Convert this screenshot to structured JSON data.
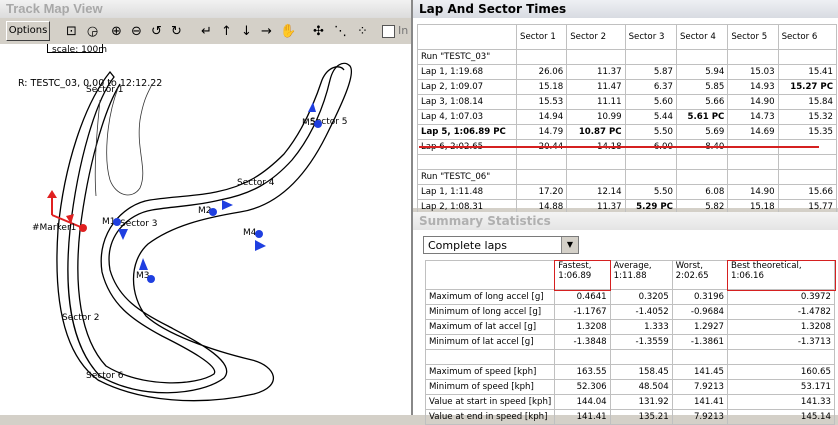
{
  "trackmap": {
    "title": "Track Map View",
    "options_label": "Options",
    "scale_label": "scale: 100m",
    "run_label": "R: TESTC_03, 0.00 to 12:12.22",
    "checkbox_label": "In",
    "marker_label": "#Marker1",
    "sector_labels": [
      "Sector 1",
      "Sector 2",
      "Sector 3",
      "Sector 4",
      "Sector 5",
      "Sector 6"
    ],
    "marker_names": [
      "M1",
      "M2",
      "M3",
      "M4",
      "M5"
    ]
  },
  "laps": {
    "title": "Lap And Sector Times",
    "headers": [
      "",
      "Sector 1",
      "Sector 2",
      "Sector 3",
      "Sector 4",
      "Sector 5",
      "Sector 6"
    ],
    "rows": [
      [
        "Run \"TESTC_03\"",
        "",
        "",
        "",
        "",
        "",
        ""
      ],
      [
        "Lap 1, 1:19.68",
        "26.06",
        "11.37",
        "5.87",
        "5.94",
        "15.03",
        "15.41"
      ],
      [
        "Lap 2, 1:09.07",
        "15.18",
        "11.47",
        "6.37",
        "5.85",
        "14.93",
        "15.27 PC"
      ],
      [
        "Lap 3, 1:08.14",
        "15.53",
        "11.11",
        "5.60",
        "5.66",
        "14.90",
        "15.84"
      ],
      [
        "Lap 4, 1:07.03",
        "14.94",
        "10.99",
        "5.44",
        "5.61 PC",
        "14.73",
        "15.32"
      ],
      [
        "Lap 5, 1:06.89 PC",
        "14.79",
        "10.87 PC",
        "5.50",
        "5.69",
        "14.69",
        "15.35"
      ],
      [
        "Lap 6, 2:02.65",
        "20.44",
        "14.18",
        "6.00",
        "8.40",
        "",
        ""
      ],
      [
        "",
        "",
        "",
        "",
        "",
        "",
        ""
      ],
      [
        "Run \"TESTC_06\"",
        "",
        "",
        "",
        "",
        "",
        ""
      ],
      [
        "Lap 1, 1:11.48",
        "17.20",
        "12.14",
        "5.50",
        "6.08",
        "14.90",
        "15.66"
      ],
      [
        "Lap 2, 1:08.31",
        "14.88",
        "11.37",
        "5.29 PC",
        "5.82",
        "15.18",
        "15.77"
      ]
    ]
  },
  "summary": {
    "title": "Summary Statistics",
    "select_value": "Complete laps",
    "headers": [
      "",
      "Fastest,\n1:06.89",
      "Average,\n1:11.88",
      "Worst,\n2:02.65",
      "Best theoretical,\n1:06.16"
    ],
    "rows": [
      [
        "Maximum of long accel [g]",
        "0.4641",
        "0.3205",
        "0.3196",
        "0.3972"
      ],
      [
        "Minimum of long accel [g]",
        "-1.1767",
        "-1.4052",
        "-0.9684",
        "-1.4782"
      ],
      [
        "Maximum of lat accel [g]",
        "1.3208",
        "1.333",
        "1.2927",
        "1.3208"
      ],
      [
        "Minimum of lat accel [g]",
        "-1.3848",
        "-1.3559",
        "-1.3861",
        "-1.3713"
      ],
      [
        "",
        "",
        "",
        "",
        ""
      ],
      [
        "Maximum of speed [kph]",
        "163.55",
        "158.45",
        "141.45",
        "160.65"
      ],
      [
        "Minimum of speed [kph]",
        "52.306",
        "48.504",
        "7.9213",
        "53.171"
      ],
      [
        "Value at start in speed [kph]",
        "144.04",
        "131.92",
        "141.41",
        "141.33"
      ],
      [
        "Value at end in speed [kph]",
        "141.41",
        "135.21",
        "7.9213",
        "145.14"
      ]
    ]
  }
}
